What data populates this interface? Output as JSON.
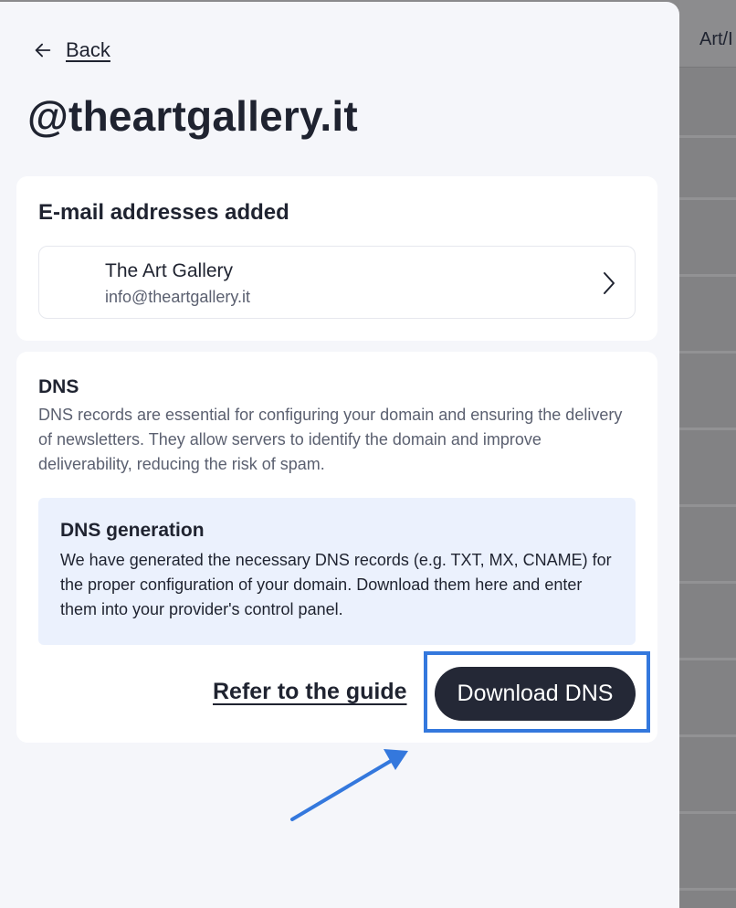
{
  "background": {
    "header_text": "Art/I"
  },
  "drawer": {
    "back_label": "Back",
    "title": "@theartgallery.it",
    "emails_section": {
      "heading": "E-mail addresses added",
      "items": [
        {
          "name": "The Art Gallery",
          "address": "info@theartgallery.it"
        }
      ]
    },
    "dns_section": {
      "heading": "DNS",
      "description": "DNS records are essential for configuring your domain and ensuring the delivery of newsletters. They allow servers to identify the domain and improve deliverability, reducing the risk of spam.",
      "info_box": {
        "title": "DNS generation",
        "text": "We have generated the necessary DNS records (e.g. TXT, MX, CNAME) for the proper configuration of your domain. Download them here and enter them into your provider's control panel."
      },
      "guide_link_label": "Refer to the guide",
      "download_button_label": "Download DNS"
    }
  },
  "annotation": {
    "highlight_color": "#3478dd",
    "arrow_color": "#3478dd"
  },
  "colors": {
    "drawer_background": "#f5f6fa",
    "card_background": "#ffffff",
    "info_background": "#ebf1fd",
    "primary_button": "#242836"
  },
  "icons": {
    "back": "arrow-left-icon",
    "email_row": "chevron-right-icon"
  }
}
